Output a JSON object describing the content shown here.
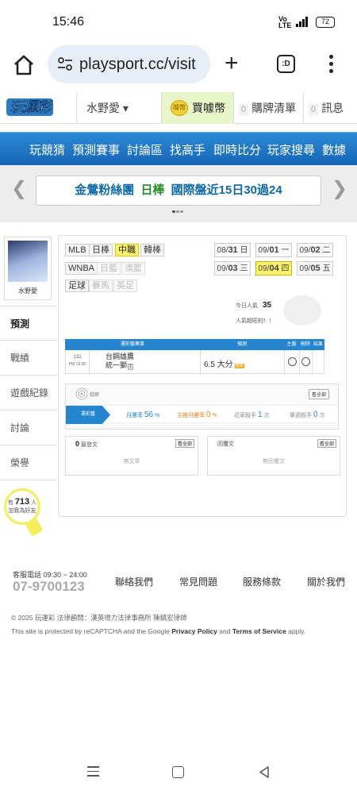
{
  "status": {
    "time": "15:46",
    "network": "Vo LTE 4G",
    "battery": "72"
  },
  "browser": {
    "url": "playsport.cc/visit",
    "tabs_count": ":D"
  },
  "header": {
    "logo": "玩運彩",
    "user": "水野愛 ▾",
    "coin_label": "買噱幣",
    "coin_icon": "噱幣",
    "cart_count": "0",
    "cart_label": "購牌清單",
    "msg_count": "0",
    "msg_label": "訊息"
  },
  "nav": {
    "items": [
      "玩競猜",
      "預測賽事",
      "討論區",
      "找高手",
      "即時比分",
      "玩家搜尋",
      "數據"
    ]
  },
  "banner": {
    "text_a": "金鶯粉絲團",
    "text_b": "日棒",
    "text_c": "國際盤近15日30過24",
    "prev": "❮",
    "next": "❯"
  },
  "profile": {
    "name": "水野愛"
  },
  "sidebar": {
    "items": [
      "預測",
      "戰績",
      "遊戲紀錄",
      "討論",
      "榮譽"
    ]
  },
  "bulb": {
    "prefix": "有",
    "count": "713",
    "suffix": "人",
    "line2": "加我為好友"
  },
  "leagues": {
    "row1": [
      "MLB",
      "日棒",
      "中職",
      "韓棒"
    ],
    "row2": [
      "WNBA",
      "日籃",
      "澳籃"
    ],
    "row3": [
      "足球",
      "賽馬",
      "英足"
    ]
  },
  "dates": [
    {
      "m": "08/",
      "d": "31",
      "w": "日"
    },
    {
      "m": "09/",
      "d": "01",
      "w": "一"
    },
    {
      "m": "09/",
      "d": "02",
      "w": "二"
    },
    {
      "m": "09/",
      "d": "03",
      "w": "三"
    },
    {
      "m": "09/",
      "d": "04",
      "w": "四"
    },
    {
      "m": "09/",
      "d": "05",
      "w": "五"
    }
  ],
  "popularity": {
    "label": "今日人氣",
    "value": "35",
    "note": "人氣超旺的！！"
  },
  "table": {
    "headers": [
      "運彩盤賽事",
      "預測",
      "主盤",
      "刪除",
      "結果"
    ],
    "row": {
      "num": "132",
      "time": "PM 16:35",
      "team1": "台鋼雄鷹",
      "team2": "統一獅",
      "team2_tag": "主",
      "pick": "6.5 大分",
      "pick_tag": "賠率"
    }
  },
  "record": {
    "label": "戰績",
    "view": "看全部",
    "strip_label": "運彩盤",
    "win_label": "月勝率",
    "win_val": "56",
    "win_unit": "%",
    "main_label": "主推月勝率",
    "main_val": "0",
    "main_unit": "%",
    "week_label": "近家殺手",
    "week_val": "1",
    "week_unit": "次",
    "season_label": "單週殺手",
    "season_val": "0",
    "season_unit": "次"
  },
  "posts": {
    "count": "0",
    "label": "篇發文",
    "view": "看全部",
    "empty": "無文章"
  },
  "replies": {
    "label": "回覆文",
    "view": "看全部",
    "empty": "無回覆文"
  },
  "footer": {
    "service": "客服電話 09:30 ~ 24:00",
    "phone": "07-9700123",
    "links": [
      "聯絡我們",
      "常見問題",
      "服務條款",
      "關於我們"
    ],
    "copyright": "© 2025 玩運彩  法律顧問：漢英得力法律事務所 陳鎮宏律師",
    "recaptcha_a": "This site is protected by reCAPTCHA and the Google",
    "privacy": "Privacy Policy",
    "and": "and",
    "terms": "Terms of Service",
    "apply": "apply."
  },
  "colors": {
    "accent": "#1f78c8",
    "highlight": "#fff36b",
    "coin_bg": "#e8f5c8"
  }
}
